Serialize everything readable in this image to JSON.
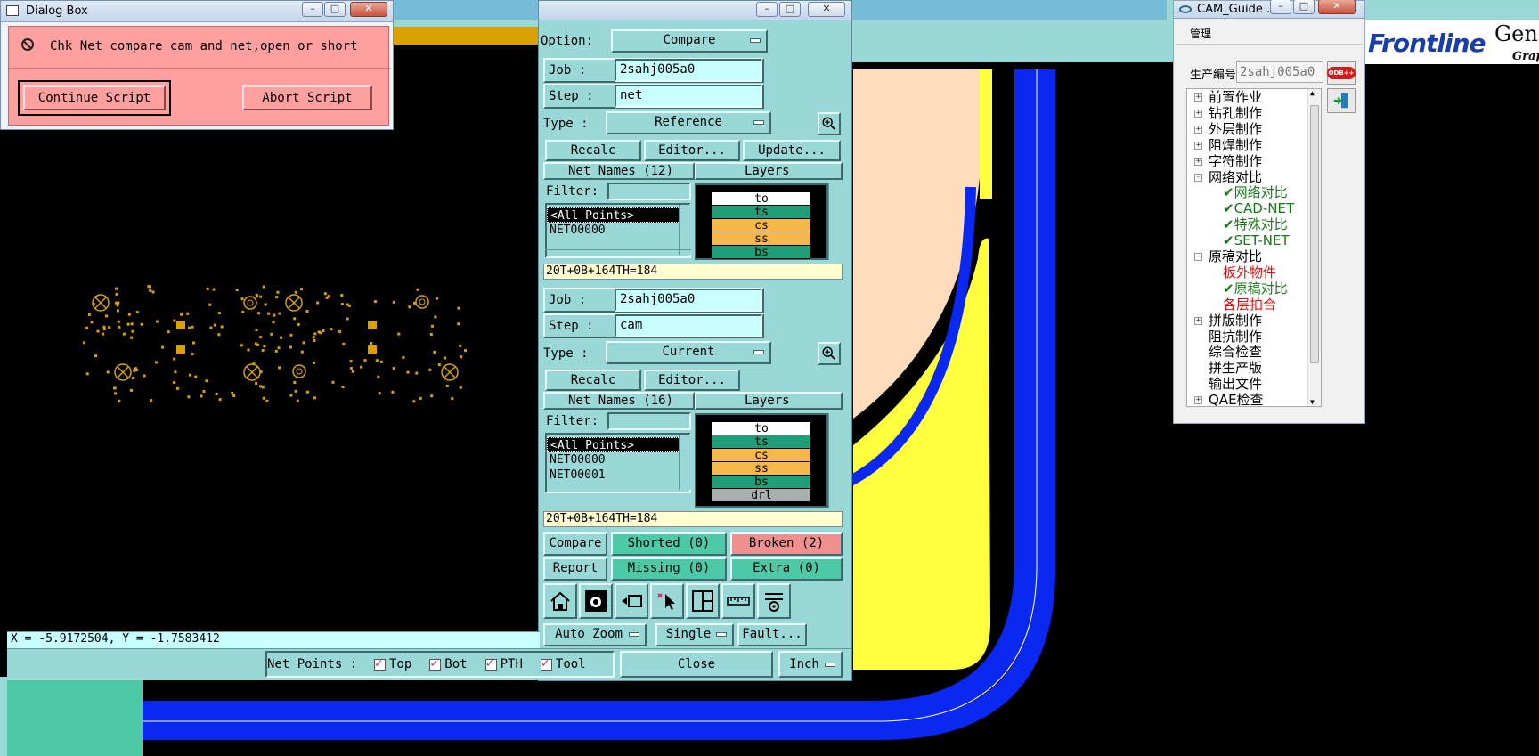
{
  "dialog": {
    "title": "Dialog Box",
    "message": "Chk Net compare cam and net,open or short",
    "continue_label": "Continue Script",
    "abort_label": "Abort Script"
  },
  "netpanel": {
    "option_label": "Option:",
    "option_value": "Compare",
    "top": {
      "job_label": "Job  :",
      "job_value": "2sahj005a0",
      "step_label": "Step :",
      "step_value": "net",
      "type_label": "Type :",
      "type_value": "Reference",
      "recalc": "Recalc",
      "editor": "Editor...",
      "update": "Update...",
      "net_names_header": "Net Names (12)",
      "layers_header": "Layers",
      "filter_label": "Filter:",
      "nets": [
        "<All Points>",
        "NET00000"
      ],
      "layers": [
        {
          "name": "to",
          "color": "#ffffff"
        },
        {
          "name": "ts",
          "color": "#1f9e78"
        },
        {
          "name": "cs",
          "color": "#f7b84b"
        },
        {
          "name": "ss",
          "color": "#f7b84b"
        },
        {
          "name": "bs",
          "color": "#1f9e78"
        }
      ],
      "summary": "20T+0B+164TH=184"
    },
    "bottom": {
      "job_label": "Job  :",
      "job_value": "2sahj005a0",
      "step_label": "Step :",
      "step_value": "cam",
      "type_label": "Type :",
      "type_value": "Current",
      "recalc": "Recalc",
      "editor": "Editor...",
      "net_names_header": "Net Names (16)",
      "layers_header": "Layers",
      "filter_label": "Filter:",
      "nets": [
        "<All Points>",
        "NET00000",
        "NET00001"
      ],
      "layers": [
        {
          "name": "to",
          "color": "#ffffff"
        },
        {
          "name": "ts",
          "color": "#1f9e78"
        },
        {
          "name": "cs",
          "color": "#f7b84b"
        },
        {
          "name": "ss",
          "color": "#f7b84b"
        },
        {
          "name": "bs",
          "color": "#1f9e78"
        },
        {
          "name": "drl",
          "color": "#a9b0b0"
        }
      ],
      "summary": "20T+0B+164TH=184"
    },
    "results": {
      "compare": "Compare",
      "report": "Report",
      "shorted": "Shorted (0)",
      "broken": "Broken (2)",
      "missing": "Missing (0)",
      "extra": "Extra (0)"
    },
    "tools": [
      "home-icon",
      "camera-icon",
      "undo-icon",
      "cursor-icon",
      "window-icon",
      "ruler-icon",
      "settings-icon"
    ],
    "auto_zoom": "Auto Zoom",
    "single": "Single",
    "fault": "Fault...",
    "net_points_label": "Net Points :",
    "net_points": [
      "Top",
      "Bot",
      "PTH",
      "Tool"
    ],
    "close": "Close",
    "units": "Inch"
  },
  "status": {
    "coords": "X = -5.9172504, Y = -1.7583412"
  },
  "guide": {
    "title": "CAM_Guide ...",
    "menu": "管理",
    "prod_label": "生产编号",
    "prod_value": "2sahj005a0",
    "odb_label": "ODB++",
    "tree": [
      {
        "label": "前置作业",
        "level": 0,
        "color": "#000000",
        "expander": "+"
      },
      {
        "label": "钻孔制作",
        "level": 0,
        "color": "#000000",
        "expander": "+"
      },
      {
        "label": "外层制作",
        "level": 0,
        "color": "#000000",
        "expander": "+"
      },
      {
        "label": "阻焊制作",
        "level": 0,
        "color": "#000000",
        "expander": "+"
      },
      {
        "label": "字符制作",
        "level": 0,
        "color": "#000000",
        "expander": "+"
      },
      {
        "label": "网络对比",
        "level": 0,
        "color": "#000000",
        "expander": "-"
      },
      {
        "label": "✔网络对比",
        "level": 1,
        "color": "#157a15",
        "expander": ""
      },
      {
        "label": "✔CAD-NET",
        "level": 1,
        "color": "#157a15",
        "expander": ""
      },
      {
        "label": "✔特殊对比",
        "level": 1,
        "color": "#157a15",
        "expander": ""
      },
      {
        "label": "✔SET-NET",
        "level": 1,
        "color": "#157a15",
        "expander": ""
      },
      {
        "label": "原稿对比",
        "level": 0,
        "color": "#000000",
        "expander": "-"
      },
      {
        "label": "板外物件",
        "level": 1,
        "color": "#e01010",
        "expander": ""
      },
      {
        "label": "✔原稿对比",
        "level": 1,
        "color": "#157a15",
        "expander": ""
      },
      {
        "label": "各层拍合",
        "level": 1,
        "color": "#e01010",
        "expander": ""
      },
      {
        "label": "拼版制作",
        "level": 0,
        "color": "#000000",
        "expander": "+"
      },
      {
        "label": "阻抗制作",
        "level": 0,
        "color": "#000000",
        "expander": ""
      },
      {
        "label": "综合检查",
        "level": 0,
        "color": "#000000",
        "expander": ""
      },
      {
        "label": "拼生产版",
        "level": 0,
        "color": "#000000",
        "expander": ""
      },
      {
        "label": "输出文件",
        "level": 0,
        "color": "#000000",
        "expander": ""
      },
      {
        "label": "QAE检查",
        "level": 0,
        "color": "#000000",
        "expander": "+"
      }
    ]
  },
  "brand": {
    "frontline": "Frontline",
    "gene": "Gene",
    "grap": "Grap"
  }
}
